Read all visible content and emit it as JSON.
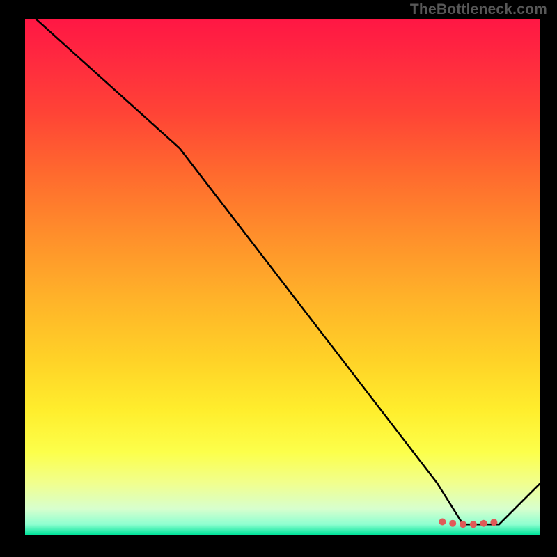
{
  "watermark": "TheBottleneck.com",
  "chart_data": {
    "type": "line",
    "title": "",
    "xlabel": "",
    "ylabel": "",
    "xlim": [
      0,
      100
    ],
    "ylim": [
      0,
      100
    ],
    "grid": false,
    "legend": false,
    "series": [
      {
        "name": "curve",
        "x": [
          0,
          10,
          20,
          30,
          40,
          50,
          60,
          70,
          80,
          85,
          92,
          100
        ],
        "values": [
          102,
          93,
          84,
          75,
          62,
          49,
          36,
          23,
          10,
          2,
          2,
          10
        ]
      }
    ],
    "markers": {
      "name": "cluster",
      "points": [
        {
          "x": 81,
          "y": 2.5
        },
        {
          "x": 83,
          "y": 2.2
        },
        {
          "x": 85,
          "y": 2.0
        },
        {
          "x": 87,
          "y": 2.0
        },
        {
          "x": 89,
          "y": 2.2
        },
        {
          "x": 91,
          "y": 2.4
        }
      ],
      "color": "#e05a58",
      "radius": 5
    },
    "background": {
      "type": "vertical-gradient",
      "top_color": "#ff1744",
      "bottom_color": "#00e39a"
    },
    "annotations": []
  }
}
